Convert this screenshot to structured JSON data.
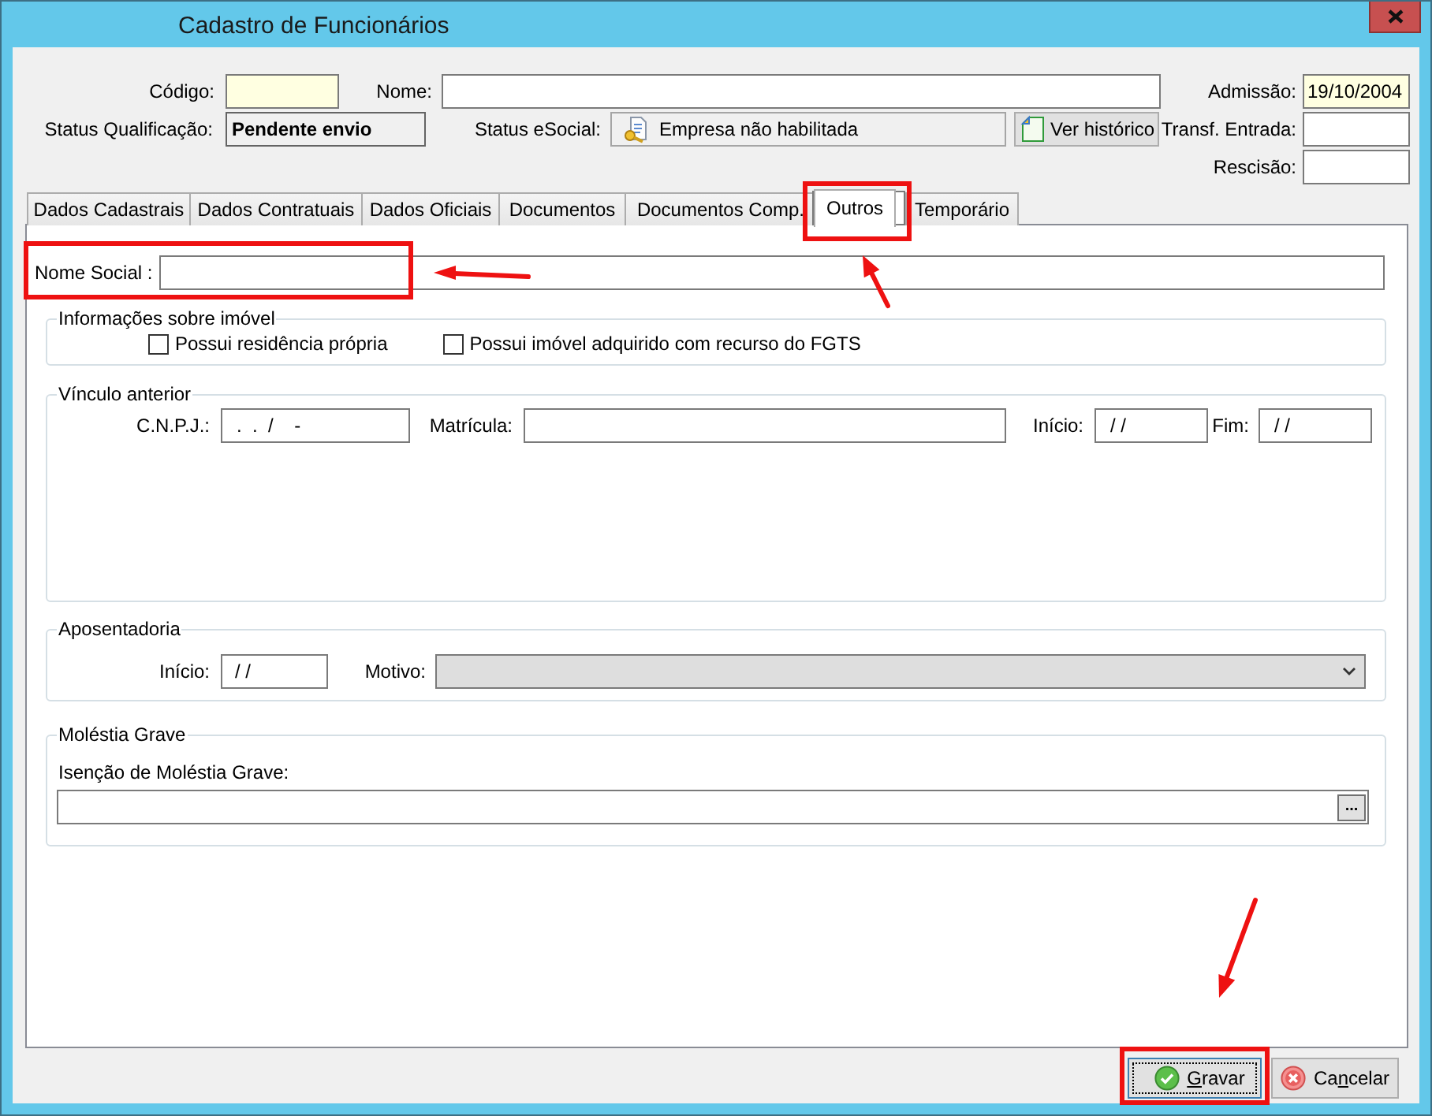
{
  "window": {
    "title": "Cadastro de Funcionários"
  },
  "header": {
    "codigo": {
      "label": "Código:",
      "required": true
    },
    "nome": {
      "label": "Nome:",
      "required": false
    },
    "admissao": {
      "label": "Admissão:",
      "value": "19/10/2004",
      "required": true
    },
    "status_qualificacao": {
      "label": "Status Qualificação:",
      "value": "Pendente envio"
    },
    "status_esocial": {
      "label": "Status eSocial:",
      "value": "Empresa não habilitada"
    },
    "history_button": {
      "label": "Ver histórico"
    },
    "transf_entrada": {
      "label": "Transf. Entrada:",
      "required": false
    },
    "rescisao": {
      "label": "Rescisão:",
      "required": false
    }
  },
  "tabs": [
    {
      "label": "Dados Cadastrais",
      "selected": false,
      "highlighted": false
    },
    {
      "label": "Dados Contratuais",
      "selected": false,
      "highlighted": false
    },
    {
      "label": "Dados Oficiais",
      "selected": false,
      "highlighted": false
    },
    {
      "label": "Documentos",
      "selected": false,
      "highlighted": false
    },
    {
      "label": "Documentos Comp.",
      "selected": false,
      "highlighted": false
    },
    {
      "label": "Outros",
      "selected": true,
      "highlighted": true
    },
    {
      "label": "Temporário",
      "selected": false,
      "highlighted": false
    }
  ],
  "nome_social": {
    "label": "Nome Social :",
    "highlighted": true
  },
  "imovel": {
    "title": "Informações sobre imóvel",
    "checkboxes": [
      {
        "label": "Possui residência própria",
        "checked": false
      },
      {
        "label": "Possui imóvel adquirido com recurso do FGTS",
        "checked": false
      }
    ]
  },
  "vinculo_anterior": {
    "title": "Vínculo anterior",
    "cnpj": {
      "label": "C.N.P.J.:",
      "value": ".  .  /    -"
    },
    "matricula": {
      "label": "Matrícula:"
    },
    "inicio": {
      "label": "Início:",
      "value": "/ /"
    },
    "fim": {
      "label": "Fim:",
      "value": "/ /"
    }
  },
  "aposentadoria": {
    "title": "Aposentadoria",
    "inicio": {
      "label": "Início:",
      "value": "/ /"
    },
    "motivo": {
      "label": "Motivo:",
      "disabled": true
    }
  },
  "molestia_grave": {
    "title": "Moléstia Grave",
    "isencao": {
      "label": "Isenção de Moléstia Grave:",
      "button": "..."
    }
  },
  "buttons": [
    {
      "kind": "save",
      "label_parts": [
        {
          "text": "G",
          "underlined": true
        },
        {
          "text": "ravar",
          "underlined": false
        }
      ],
      "focused": true,
      "highlighted": true
    },
    {
      "kind": "cancel",
      "label_parts": [
        {
          "text": "Ca",
          "underlined": false
        },
        {
          "text": "n",
          "underlined": true
        },
        {
          "text": "celar",
          "underlined": false
        }
      ],
      "focused": false,
      "highlighted": false
    }
  ]
}
